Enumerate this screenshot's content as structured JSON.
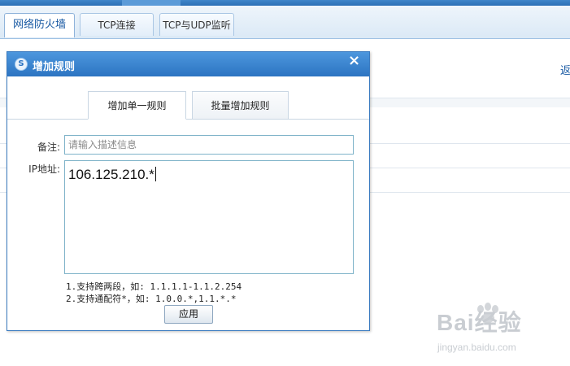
{
  "main_tabs": [
    {
      "label": "网络防火墙",
      "active": true
    },
    {
      "label": "TCP连接",
      "active": false
    },
    {
      "label": "TCP与UDP监听",
      "active": false
    }
  ],
  "edge_text": "返",
  "dialog": {
    "title": "增加规则",
    "close_glyph": "×",
    "logo_glyph": "S",
    "tabs": [
      {
        "label": "增加单一规则",
        "active": true
      },
      {
        "label": "批量增加规则",
        "active": false
      }
    ],
    "note_label": "备注:",
    "note_placeholder": "请输入描述信息",
    "ip_label": "IP地址:",
    "ip_value": "106.125.210.*",
    "hints": [
      "1.支持跨两段，如: 1.1.1.1-1.1.2.254",
      "2.支持通配符*，如: 1.0.0.*,1.1.*.*"
    ],
    "apply_label": "应用"
  },
  "watermark": {
    "brand": "Bai经验",
    "url": "jingyan.baidu.com"
  },
  "colors": {
    "title_bar": "#2c74c2",
    "input_border": "#7fb3c9",
    "active_tab_text": "#1a5aa3"
  }
}
